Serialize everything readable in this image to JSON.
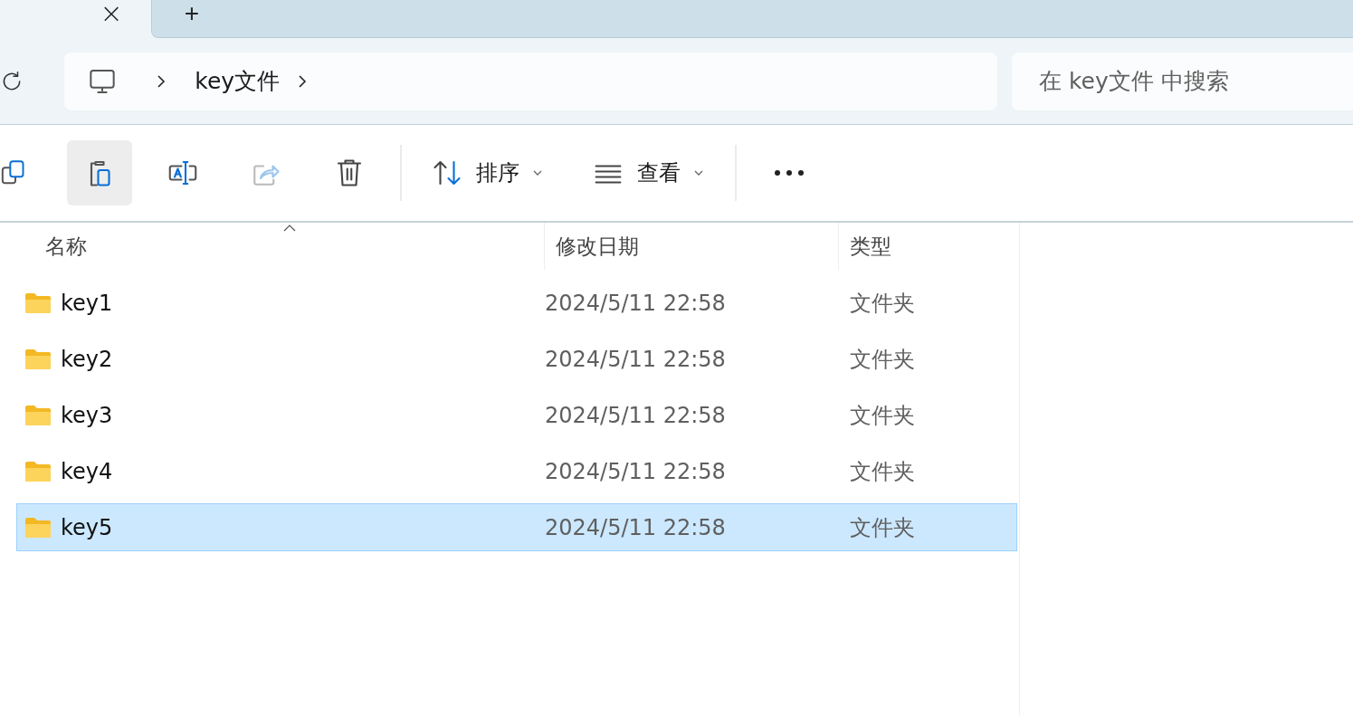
{
  "tabs": {
    "close_label": "×",
    "new_tab_label": "+"
  },
  "address_bar": {
    "breadcrumbs": [
      "key文件"
    ],
    "search": {
      "placeholder": "在 key文件 中搜索"
    }
  },
  "toolbar": {
    "items": [
      {
        "kind": "icon",
        "disabled": false,
        "highlighted": false
      },
      {
        "kind": "icon",
        "disabled": false,
        "highlighted": true
      },
      {
        "kind": "icon",
        "disabled": false,
        "highlighted": false
      },
      {
        "kind": "icon",
        "disabled": true,
        "highlighted": false
      },
      {
        "kind": "icon",
        "disabled": false,
        "highlighted": false
      },
      {
        "kind": "separator"
      },
      {
        "kind": "menu",
        "label": "排序"
      },
      {
        "kind": "menu",
        "label": "查看"
      },
      {
        "kind": "separator"
      },
      {
        "kind": "more"
      }
    ]
  },
  "table": {
    "columns": [
      "名称",
      "修改日期",
      "类型"
    ],
    "rows": [
      {
        "name": "key1",
        "modified": "2024/5/11 22:58",
        "type": "文件夹",
        "selected": false
      },
      {
        "name": "key2",
        "modified": "2024/5/11 22:58",
        "type": "文件夹",
        "selected": false
      },
      {
        "name": "key3",
        "modified": "2024/5/11 22:58",
        "type": "文件夹",
        "selected": false
      },
      {
        "name": "key4",
        "modified": "2024/5/11 22:58",
        "type": "文件夹",
        "selected": false
      },
      {
        "name": "key5",
        "modified": "2024/5/11 22:58",
        "type": "文件夹",
        "selected": true
      }
    ]
  }
}
